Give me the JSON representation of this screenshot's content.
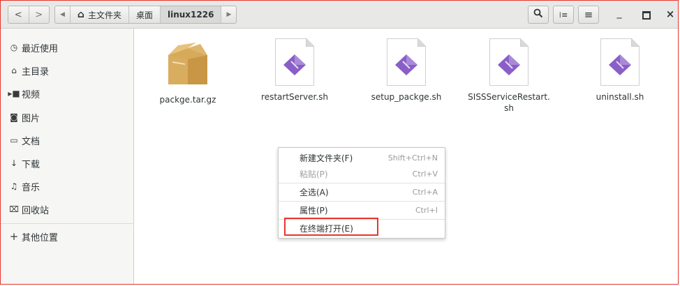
{
  "nav": {
    "back": "<",
    "forward": ">"
  },
  "breadcrumb": {
    "left_arrow": "◀",
    "home_icon": "⌂",
    "home_label": "主文件夹",
    "desktop_label": "桌面",
    "current_label": "linux1226",
    "right_arrow": "▶"
  },
  "toolbar": {
    "search_icon": "🔍",
    "view_icon": "⁞≡",
    "menu_icon": "≡",
    "minimize": "_",
    "maximize": "□",
    "close": "×"
  },
  "sidebar": {
    "items": [
      {
        "icon": "◷",
        "label": "最近使用"
      },
      {
        "icon": "⌂",
        "label": "主目录"
      },
      {
        "icon": "▸■",
        "label": "视频"
      },
      {
        "icon": "◙",
        "label": "图片"
      },
      {
        "icon": "▭",
        "label": "文档"
      },
      {
        "icon": "↓",
        "label": "下载"
      },
      {
        "icon": "♫",
        "label": "音乐"
      },
      {
        "icon": "⌧",
        "label": "回收站"
      }
    ],
    "other": {
      "icon": "+",
      "label": "其他位置"
    }
  },
  "files": [
    {
      "type": "archive",
      "name": "packge.tar.gz"
    },
    {
      "type": "script",
      "name": "restartServer.sh"
    },
    {
      "type": "script",
      "name": "setup_packge.sh"
    },
    {
      "type": "script",
      "name": "SISSServiceRestart.sh"
    },
    {
      "type": "script",
      "name": "uninstall.sh"
    }
  ],
  "context_menu": {
    "items": [
      {
        "label": "新建文件夹(F)",
        "shortcut": "Shift+Ctrl+N"
      },
      {
        "label": "粘贴(P)",
        "shortcut": "Ctrl+V"
      },
      {
        "label": "全选(A)",
        "shortcut": "Ctrl+A"
      },
      {
        "label": "属性(P)",
        "shortcut": "Ctrl+I"
      },
      {
        "label": "在终端打开(E)",
        "shortcut": ""
      }
    ]
  },
  "colors": {
    "highlight": "#e8352c",
    "script_icon": "#8a5ec7",
    "archive_icon": "#d7aa5b"
  }
}
